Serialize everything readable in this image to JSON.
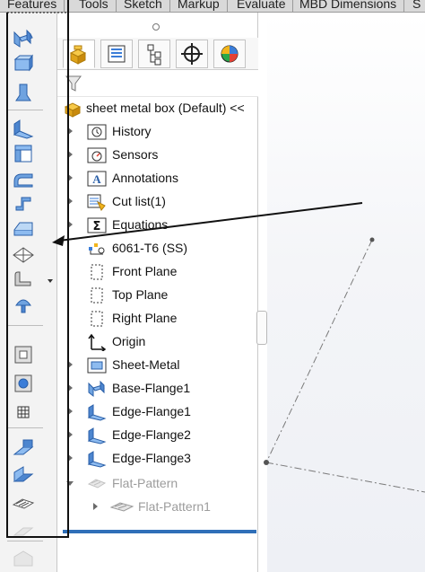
{
  "command_tabs": [
    "Features",
    "Tools",
    "Sketch",
    "Markup",
    "Evaluate",
    "MBD Dimensions",
    "S"
  ],
  "feature_manager": {
    "tabs": [
      "feature-tree-tab",
      "property-tab",
      "configuration-tab",
      "dimxpert-tab",
      "display-tab"
    ],
    "root_label": "sheet metal box  (Default) <<",
    "items": [
      {
        "label": "History",
        "icon": "history-folder-icon",
        "expandable": true
      },
      {
        "label": "Sensors",
        "icon": "sensors-icon",
        "expandable": true
      },
      {
        "label": "Annotations",
        "icon": "annotations-icon",
        "expandable": true
      },
      {
        "label": "Cut list(1)",
        "icon": "cut-list-icon",
        "expandable": true
      },
      {
        "label": "Equations",
        "icon": "equations-icon",
        "expandable": true
      },
      {
        "label": "6061-T6 (SS)",
        "icon": "material-icon",
        "expandable": false
      },
      {
        "label": "Front Plane",
        "icon": "plane-icon",
        "expandable": false
      },
      {
        "label": "Top Plane",
        "icon": "plane-icon",
        "expandable": false
      },
      {
        "label": "Right Plane",
        "icon": "plane-icon",
        "expandable": false
      },
      {
        "label": "Origin",
        "icon": "origin-icon",
        "expandable": false
      },
      {
        "label": "Sheet-Metal",
        "icon": "sheet-metal-icon",
        "expandable": true
      },
      {
        "label": "Base-Flange1",
        "icon": "base-flange-icon",
        "expandable": true
      },
      {
        "label": "Edge-Flange1",
        "icon": "edge-flange-icon",
        "expandable": true
      },
      {
        "label": "Edge-Flange2",
        "icon": "edge-flange-icon",
        "expandable": true
      },
      {
        "label": "Edge-Flange3",
        "icon": "edge-flange-icon",
        "expandable": true
      },
      {
        "label": "Flat-Pattern",
        "icon": "flat-pattern-icon",
        "expandable": true,
        "suppressed": true
      },
      {
        "label": "Flat-Pattern1",
        "icon": "flat-pattern-icon",
        "expandable": true,
        "suppressed": true,
        "child": true
      }
    ]
  },
  "colors": {
    "accent_blue": "#2f6fb8",
    "icon_blue": "#3b7dd8",
    "icon_yellow": "#f2b51c",
    "annotation_line": "#111111"
  }
}
